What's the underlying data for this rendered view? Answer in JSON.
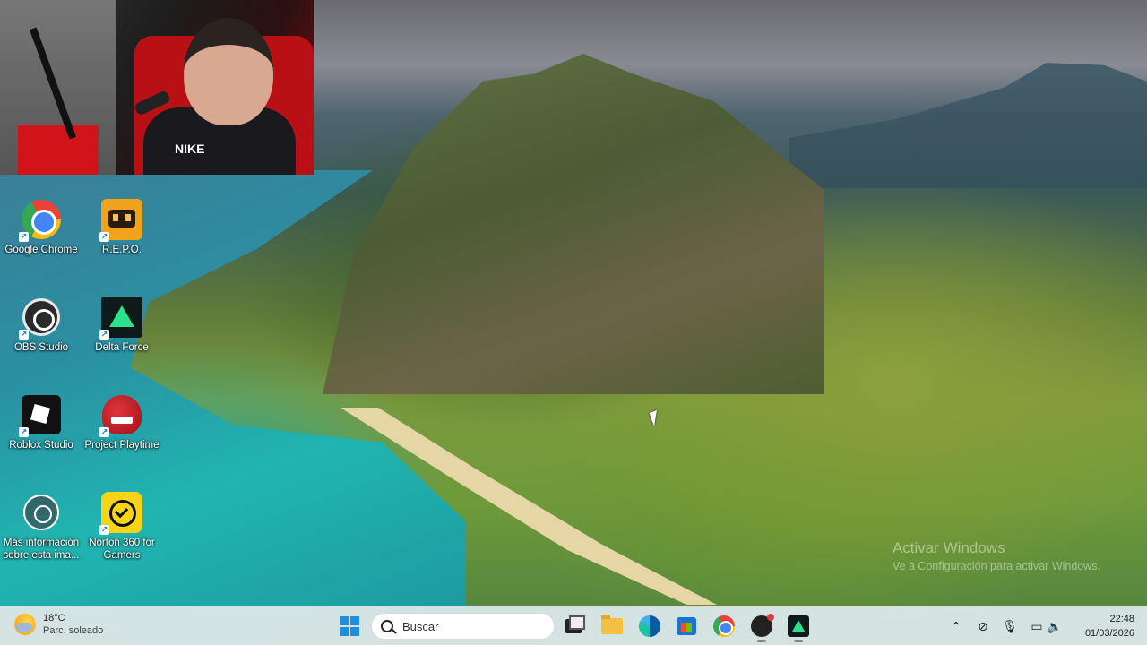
{
  "desktop": {
    "icons": [
      {
        "label": "Google Chrome",
        "icon": "chrome-icon"
      },
      {
        "label": "R.E.P.O.",
        "icon": "repo-icon"
      },
      {
        "label": "OBS Studio",
        "icon": "obs-icon"
      },
      {
        "label": "Delta Force",
        "icon": "delta-force-icon"
      },
      {
        "label": "Roblox Studio",
        "icon": "roblox-icon"
      },
      {
        "label": "Project Playtime",
        "icon": "project-playtime-icon"
      },
      {
        "label": "Más información sobre esta ima...",
        "icon": "info-icon"
      },
      {
        "label": "Norton 360 for Gamers",
        "icon": "norton-icon"
      }
    ]
  },
  "webcam": {
    "shirt_text": "NIKE"
  },
  "watermark": {
    "title": "Activar Windows",
    "subtitle": "Ve a Configuración para activar Windows."
  },
  "taskbar": {
    "weather": {
      "temp": "18°C",
      "condition": "Parc. soleado"
    },
    "search": {
      "placeholder": "Buscar"
    },
    "apps": [
      "task-view-icon",
      "file-explorer-icon",
      "edge-icon",
      "store-icon",
      "chrome-icon",
      "obs-icon",
      "delta-force-icon"
    ],
    "tray": [
      "chevron-up-icon",
      "network-off-icon",
      "microphone-icon",
      "display-icon",
      "volume-icon"
    ],
    "clock": {
      "time": "22:48",
      "date": "01/03/2026"
    }
  }
}
